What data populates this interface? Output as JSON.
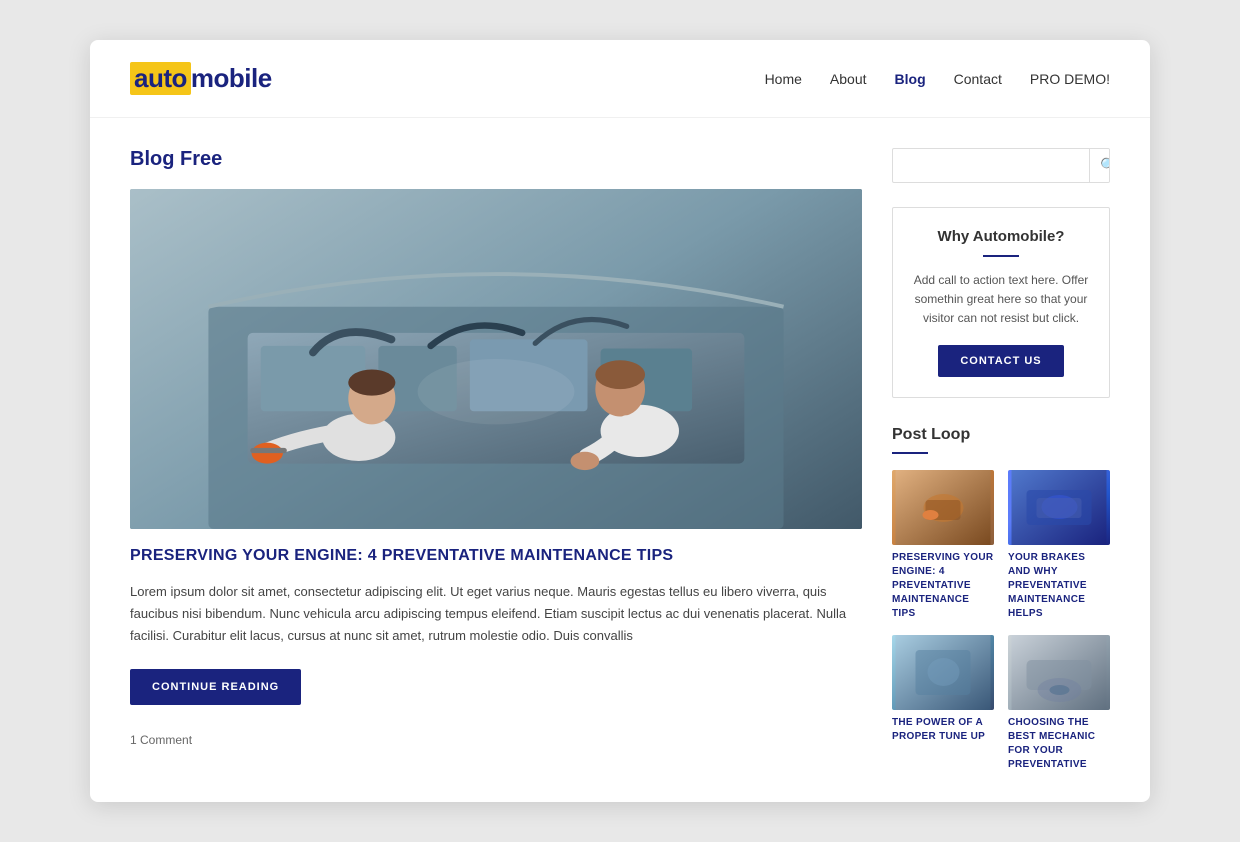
{
  "site": {
    "logo_auto": "auto",
    "logo_mobile": "mobile",
    "nav": [
      {
        "label": "Home",
        "active": false
      },
      {
        "label": "About",
        "active": false
      },
      {
        "label": "Blog",
        "active": true
      },
      {
        "label": "Contact",
        "active": false
      },
      {
        "label": "PRO DEMO!",
        "active": false
      }
    ]
  },
  "main": {
    "blog_title": "Blog Free",
    "article": {
      "heading": "PRESERVING YOUR ENGINE: 4 PREVENTATIVE MAINTENANCE TIPS",
      "body": "Lorem ipsum dolor sit amet, consectetur adipiscing elit. Ut eget varius neque. Mauris egestas tellus eu libero viverra, quis faucibus nisi bibendum. Nunc vehicula arcu adipiscing tempus eleifend. Etiam suscipit lectus ac dui venenatis placerat. Nulla facilisi. Curabitur elit lacus, cursus at nunc sit amet, rutrum molestie odio. Duis convallis",
      "continue_btn": "CONTINUE READING",
      "comment_count": "1 Comment"
    }
  },
  "sidebar": {
    "search_placeholder": "",
    "cta": {
      "title": "Why Automobile?",
      "text": "Add call to action text here. Offer somethin great here so that your visitor can not resist but click.",
      "contact_btn": "CONTACT US"
    },
    "post_loop": {
      "title": "Post Loop",
      "posts": [
        {
          "label": "PRESERVING YOUR ENGINE: 4 PREVENTATIVE MAINTENANCE TIPS",
          "thumb": "thumb-1"
        },
        {
          "label": "YOUR BRAKES AND WHY PREVENTATIVE MAINTENANCE HELPS",
          "thumb": "thumb-2"
        },
        {
          "label": "THE POWER OF A PROPER TUNE UP",
          "thumb": "thumb-3"
        },
        {
          "label": "CHOOSING THE BEST MECHANIC FOR YOUR PREVENTATIVE",
          "thumb": "thumb-4"
        }
      ]
    }
  }
}
